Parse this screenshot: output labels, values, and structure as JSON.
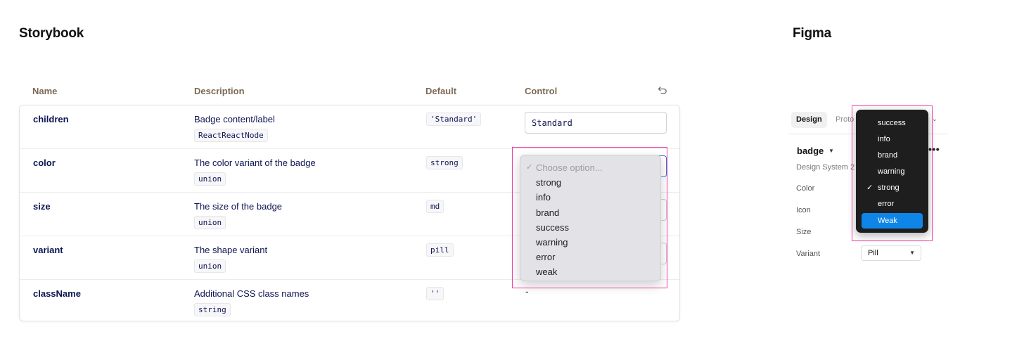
{
  "storybook": {
    "title": "Storybook",
    "headers": {
      "name": "Name",
      "description": "Description",
      "default": "Default",
      "control": "Control"
    },
    "rows": [
      {
        "name": "children",
        "description": "Badge content/label",
        "type": "ReactReactNode",
        "default": "'Standard'",
        "control": "Standard"
      },
      {
        "name": "color",
        "description": "The color variant of the badge",
        "type": "union",
        "default": "strong",
        "control": ""
      },
      {
        "name": "size",
        "description": "The size of the badge",
        "type": "union",
        "default": "md",
        "control": ""
      },
      {
        "name": "variant",
        "description": "The shape variant",
        "type": "union",
        "default": "pill",
        "control": ""
      },
      {
        "name": "className",
        "description": "Additional CSS class names",
        "type": "string",
        "default": "''",
        "control": "-"
      }
    ],
    "dropdown": {
      "placeholder": "Choose option...",
      "check_glyph": "✓",
      "options": [
        "strong",
        "info",
        "brand",
        "success",
        "warning",
        "error",
        "weak"
      ]
    },
    "highlight_color": "#ee3fa6"
  },
  "figma": {
    "title": "Figma",
    "tabs": {
      "design": "Design",
      "prototype": "Proto"
    },
    "component": "badge",
    "subtitle": "Design System 2",
    "props": [
      "Color",
      "Icon",
      "Size",
      "Variant"
    ],
    "variant_value": "Pill",
    "dropdown": {
      "options": [
        "success",
        "info",
        "brand",
        "warning",
        "strong",
        "error",
        "Weak"
      ],
      "checked": "strong",
      "highlighted": "Weak",
      "check_glyph": "✓"
    },
    "accent": "#1085e8"
  }
}
